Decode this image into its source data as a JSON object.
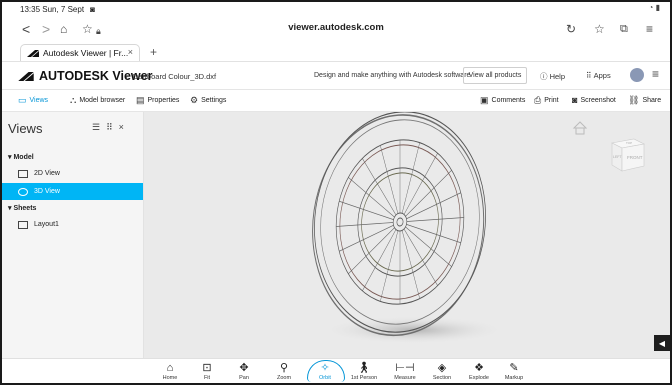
{
  "status": {
    "time_date": "13:35  Sun, 7 Sept",
    "right_icons": "signal-battery"
  },
  "browser": {
    "url": "viewer.autodesk.com",
    "tab_label": "Autodesk Viewer | Fr...",
    "tab_close": "×",
    "new_tab": "+"
  },
  "header": {
    "brand": "AUTODESK Viewer",
    "breadcrumb": "Dartboard Colour_3D.dxf",
    "tagline": "Design and make anything with Autodesk software",
    "view_all": "View all products",
    "help": "Help",
    "apps": "Apps"
  },
  "toolbar": {
    "views": "Views",
    "model_browser": "Model browser",
    "properties": "Properties",
    "settings": "Settings",
    "comments": "Comments",
    "print": "Print",
    "screenshot": "Screenshot",
    "share": "Share"
  },
  "sidebar": {
    "title": "Views",
    "close": "×",
    "model_header": "Model",
    "model_items": [
      "2D View",
      "3D View"
    ],
    "sheets_header": "Sheets",
    "sheet_items": [
      "Layout1"
    ]
  },
  "viewcube": {
    "left_face": "LEFT",
    "front_face": "FRONT",
    "top_face": "TOP"
  },
  "bottom_tools": [
    "Home",
    "Fit",
    "Pan",
    "Zoom",
    "Orbit",
    "1st Person",
    "Measure",
    "Section",
    "Explode",
    "Markup"
  ],
  "active_tool": "Orbit",
  "colors": {
    "accent": "#0696d7",
    "selected_item": "#00b5f5",
    "canvas": "#eaeaea"
  }
}
